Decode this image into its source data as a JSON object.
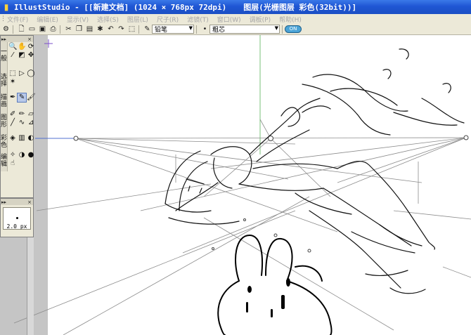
{
  "window": {
    "app_name": "IllustStudio",
    "title": "IllustStudio - [[新建文档] (1024 × 768px 72dpi)",
    "layer_info": "图层(光栅图层 彩色(32bit))]"
  },
  "menu": [
    {
      "label": "文件(F)"
    },
    {
      "label": "编辑(E)"
    },
    {
      "label": "显示(V)"
    },
    {
      "label": "选择(S)"
    },
    {
      "label": "图层(L)"
    },
    {
      "label": "尺子(R)"
    },
    {
      "label": "滤镜(T)"
    },
    {
      "label": "窗口(W)"
    },
    {
      "label": "调板(P)"
    },
    {
      "label": "帮助(H)"
    }
  ],
  "toolbar": {
    "tool_combo_value": "铅笔",
    "brush_combo_value": "粗芯",
    "brush_marker": "•",
    "toggle_label": "ON"
  },
  "tool_tabs": [
    {
      "label": "一般"
    },
    {
      "label": "选择"
    },
    {
      "label": "描画"
    },
    {
      "label": "图形"
    },
    {
      "label": "彩色"
    },
    {
      "label": "编辑"
    }
  ],
  "brush_panel": {
    "size_label": "2.0 px"
  },
  "icons": {
    "app": "app-logo-icon",
    "new": "new-document-icon",
    "open": "open-folder-icon",
    "save": "save-icon",
    "print": "print-icon",
    "cut": "cut-icon",
    "copy": "copy-icon",
    "paste": "paste-icon",
    "undo": "undo-icon",
    "redo": "redo-icon",
    "pencil": "pencil-icon"
  },
  "colors": {
    "titlebar": "#2458d3",
    "panel_bg": "#ece9d8",
    "ruler_line": "#7ac07a"
  }
}
